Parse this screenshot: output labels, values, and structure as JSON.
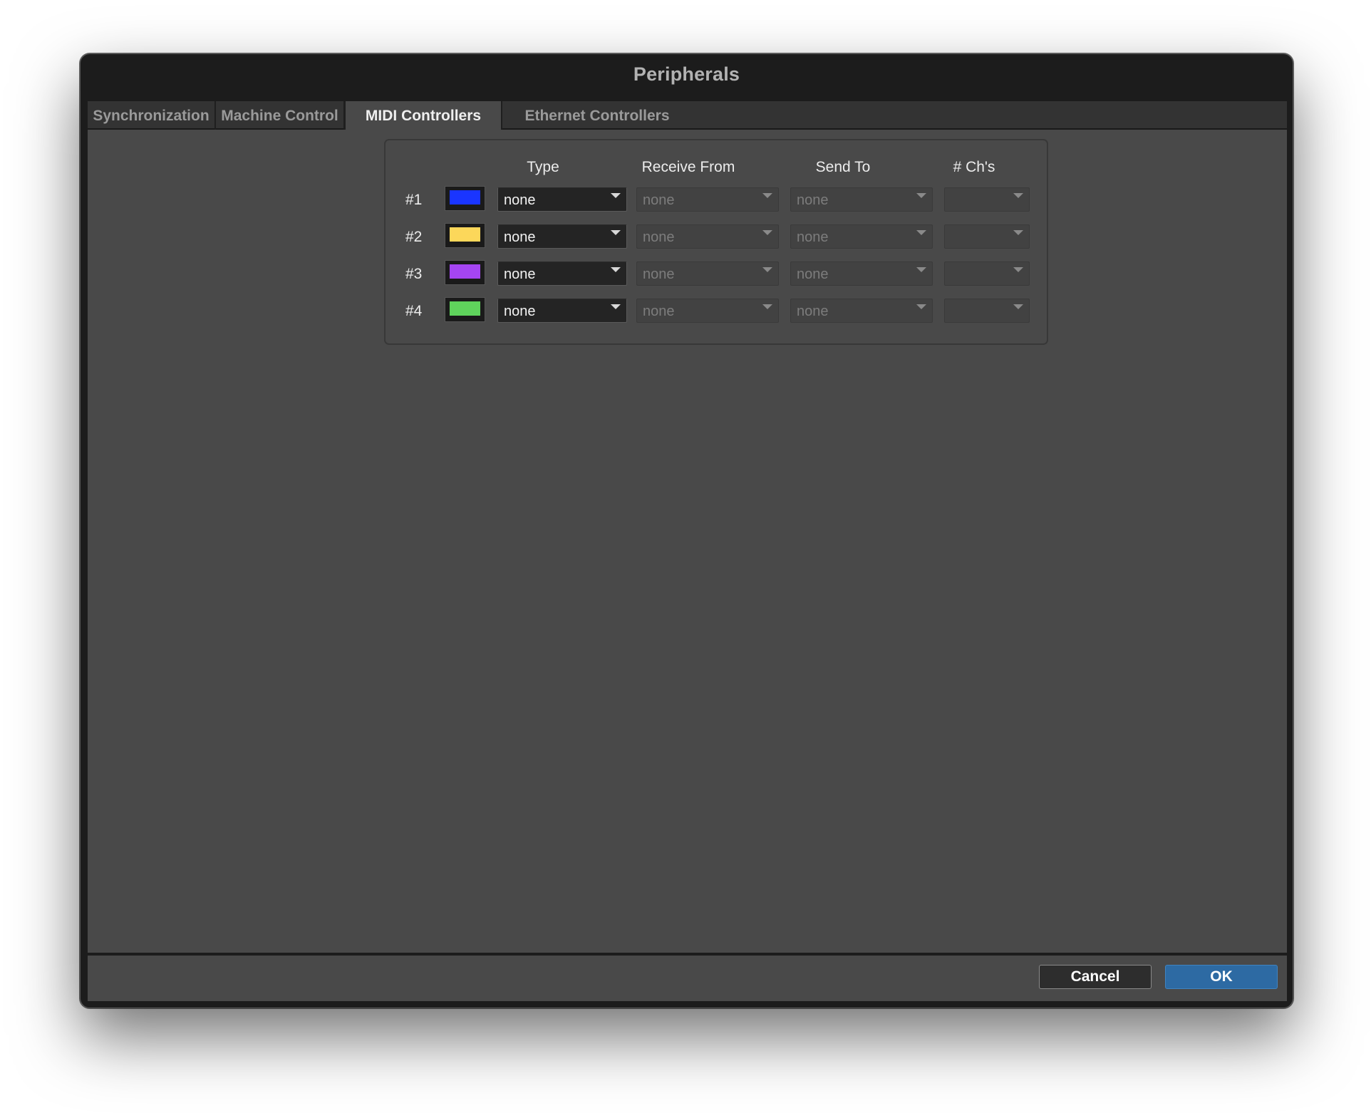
{
  "window": {
    "title": "Peripherals"
  },
  "tabs": [
    {
      "label": "Synchronization",
      "active": false
    },
    {
      "label": "Machine Control",
      "active": false
    },
    {
      "label": "MIDI Controllers",
      "active": true
    },
    {
      "label": "Ethernet Controllers",
      "active": false
    }
  ],
  "table": {
    "headers": {
      "type": "Type",
      "receive_from": "Receive From",
      "send_to": "Send To",
      "channels": "# Ch's"
    },
    "rows": [
      {
        "label": "#1",
        "color": "#1a35ff",
        "type": "none",
        "receive_from": "none",
        "send_to": "none",
        "channels": ""
      },
      {
        "label": "#2",
        "color": "#fcd75a",
        "type": "none",
        "receive_from": "none",
        "send_to": "none",
        "channels": ""
      },
      {
        "label": "#3",
        "color": "#a545f2",
        "type": "none",
        "receive_from": "none",
        "send_to": "none",
        "channels": ""
      },
      {
        "label": "#4",
        "color": "#5fd35c",
        "type": "none",
        "receive_from": "none",
        "send_to": "none",
        "channels": ""
      }
    ]
  },
  "footer": {
    "cancel_label": "Cancel",
    "ok_label": "OK"
  },
  "icons": {
    "dropdown_arrow": "chevron-down-icon"
  }
}
